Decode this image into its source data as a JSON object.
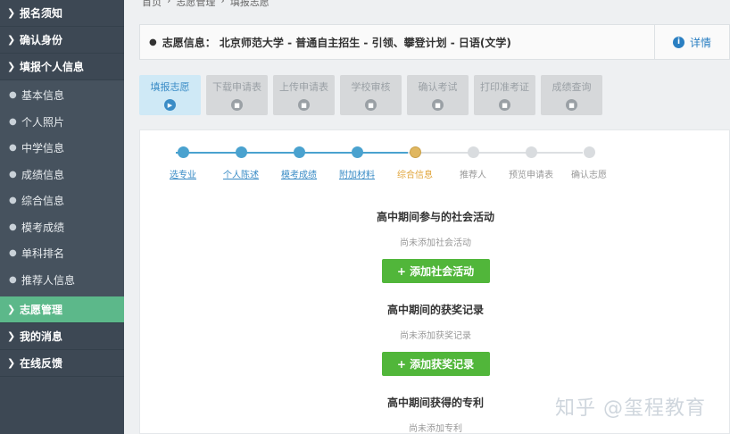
{
  "sidebar": {
    "top_items": [
      {
        "label": "报名须知"
      },
      {
        "label": "确认身份"
      },
      {
        "label": "填报个人信息"
      }
    ],
    "sub_items": [
      {
        "label": "基本信息"
      },
      {
        "label": "个人照片"
      },
      {
        "label": "中学信息"
      },
      {
        "label": "成绩信息"
      },
      {
        "label": "综合信息"
      },
      {
        "label": "模考成绩"
      },
      {
        "label": "单科排名"
      },
      {
        "label": "推荐人信息"
      }
    ],
    "bottom_items": [
      {
        "label": "志愿管理",
        "active": true
      },
      {
        "label": "我的消息"
      },
      {
        "label": "在线反馈"
      }
    ],
    "accent_color": "#5cb88a"
  },
  "breadcrumb": [
    "首页",
    "志愿管理",
    "填报志愿"
  ],
  "info_bar": {
    "text": "志愿信息： 北京师范大学 - 普通自主招生 - 引领、攀登计划 - 日语(文学)",
    "detail_label": "详情"
  },
  "tabs": [
    {
      "label": "填报志愿",
      "active": true
    },
    {
      "label": "下载申请表"
    },
    {
      "label": "上传申请表"
    },
    {
      "label": "学校审核"
    },
    {
      "label": "确认考试"
    },
    {
      "label": "打印准考证"
    },
    {
      "label": "成绩查询"
    }
  ],
  "steps": [
    {
      "label": "选专业",
      "status": "done"
    },
    {
      "label": "个人陈述",
      "status": "done"
    },
    {
      "label": "模考成绩",
      "status": "done"
    },
    {
      "label": "附加材料",
      "status": "done"
    },
    {
      "label": "综合信息",
      "status": "current"
    },
    {
      "label": "推荐人",
      "status": "todo"
    },
    {
      "label": "预览申请表",
      "status": "todo"
    },
    {
      "label": "确认志愿",
      "status": "todo"
    }
  ],
  "sections": [
    {
      "title": "高中期间参与的社会活动",
      "empty": "尚未添加社会活动",
      "button": "+ 添加社会活动"
    },
    {
      "title": "高中期间的获奖记录",
      "empty": "尚未添加获奖记录",
      "button": "+ 添加获奖记录"
    },
    {
      "title": "高中期间获得的专利",
      "empty": "尚未添加专利"
    }
  ],
  "watermark": "知乎 @玺程教育",
  "colors": {
    "sidebar_bg": "#3d4854",
    "primary_blue": "#3a8cc6",
    "add_button_green": "#51b63a",
    "current_step": "#e0b760"
  }
}
